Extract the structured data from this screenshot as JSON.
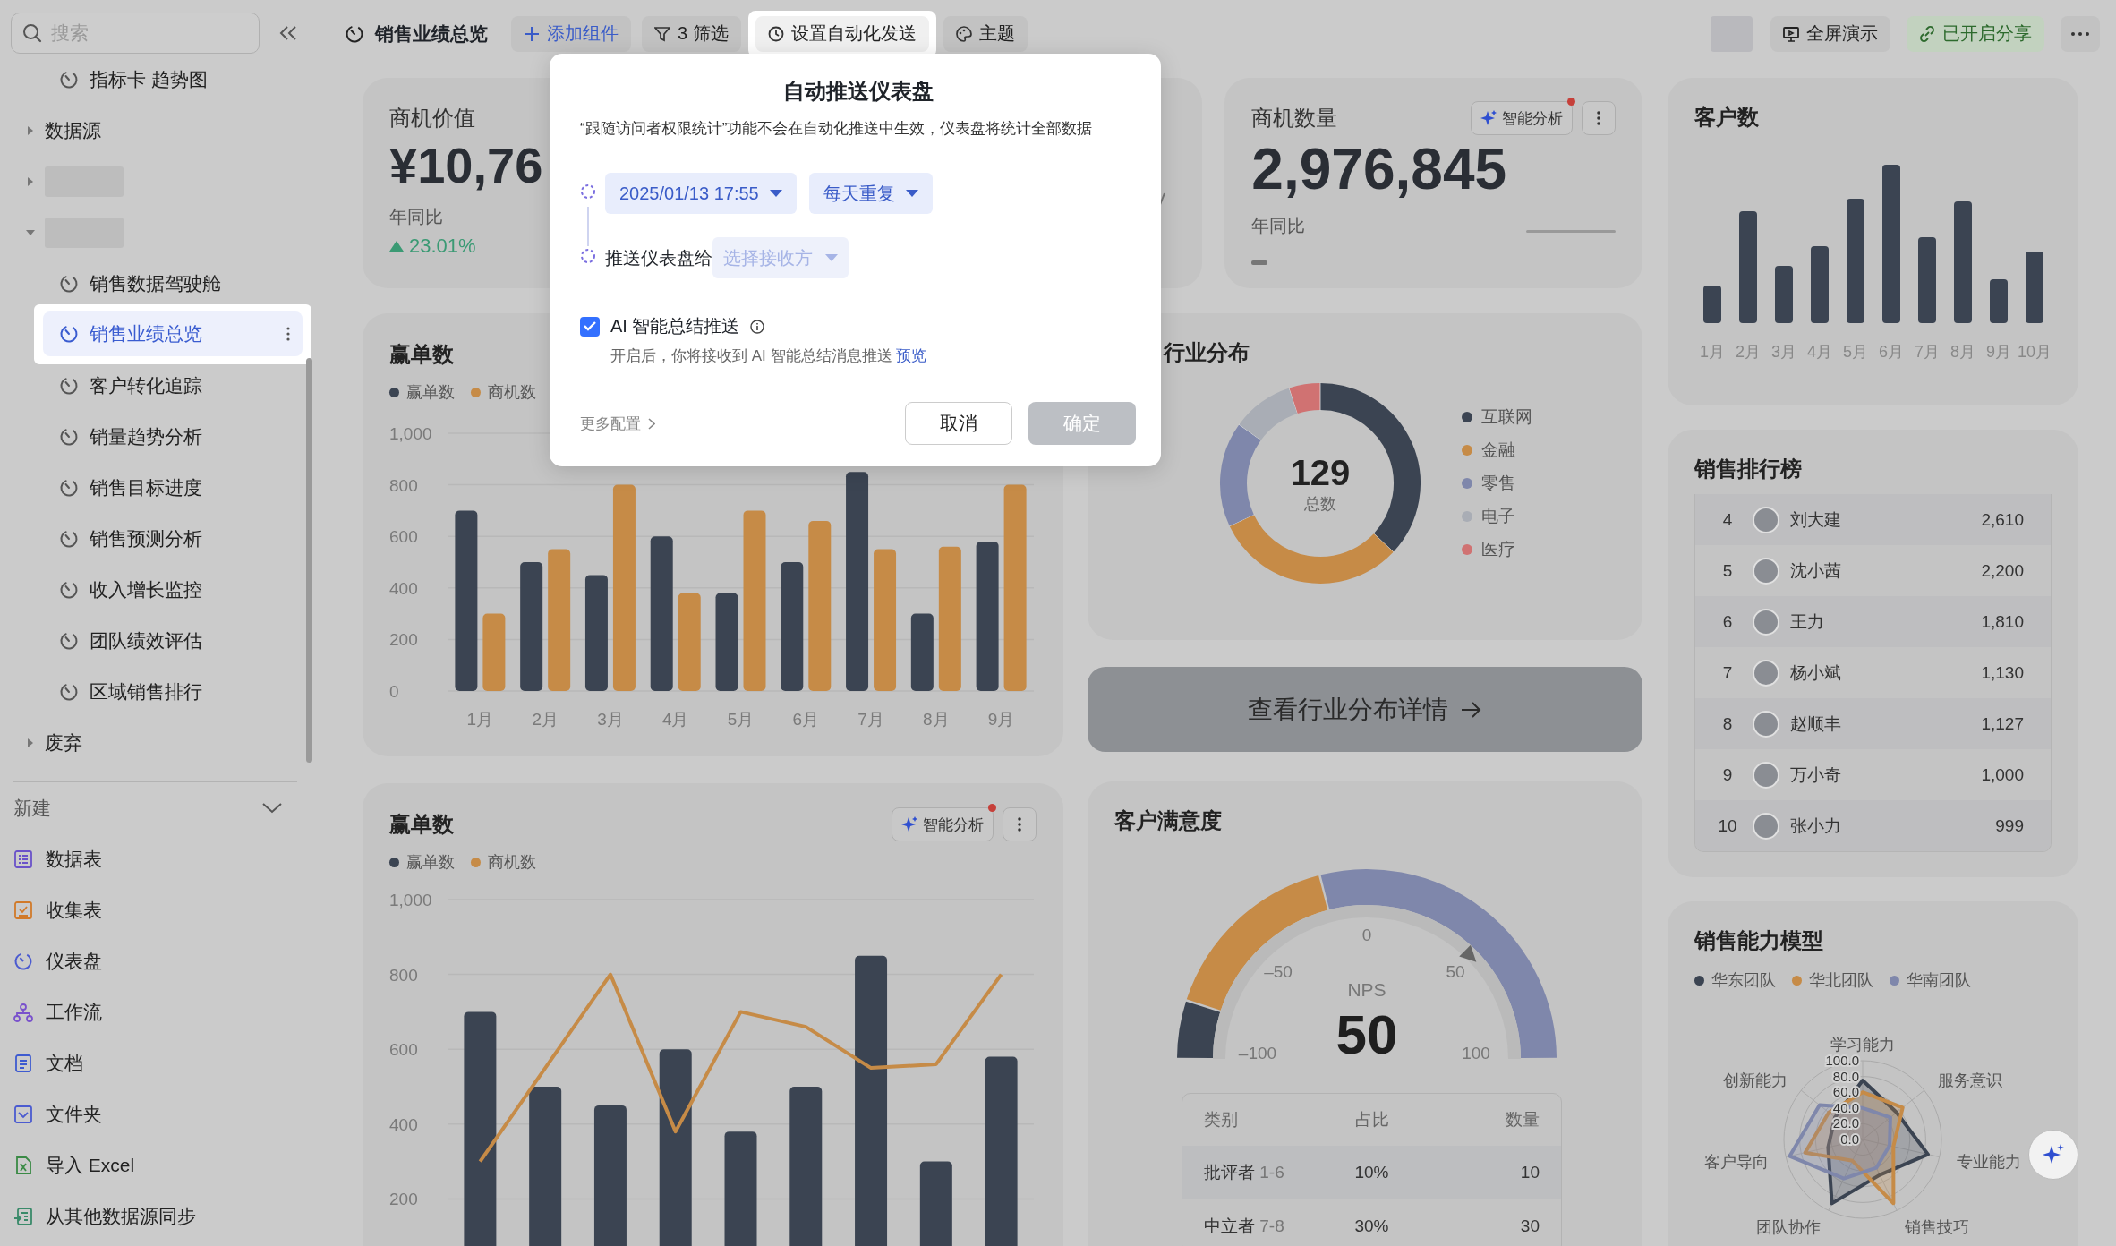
{
  "sidebar": {
    "search": {
      "placeholder": "搜索"
    },
    "tree": [
      {
        "kind": "dashboard",
        "label": "指标卡 趋势图",
        "selected": false
      },
      {
        "kind": "folder",
        "label": "数据源",
        "expanded": false
      },
      {
        "kind": "folder",
        "redacted": true,
        "expanded": false
      },
      {
        "kind": "folder",
        "redacted": true,
        "expanded": true,
        "children": [
          {
            "kind": "dashboard",
            "label": "销售数据驾驶舱",
            "selected": false
          },
          {
            "kind": "dashboard",
            "label": "销售业绩总览",
            "selected": true
          },
          {
            "kind": "dashboard",
            "label": "客户转化追踪",
            "selected": false
          },
          {
            "kind": "dashboard",
            "label": "销量趋势分析",
            "selected": false
          },
          {
            "kind": "dashboard",
            "label": "销售目标进度",
            "selected": false
          },
          {
            "kind": "dashboard",
            "label": "销售预测分析",
            "selected": false
          },
          {
            "kind": "dashboard",
            "label": "收入增长监控",
            "selected": false
          },
          {
            "kind": "dashboard",
            "label": "团队绩效评估",
            "selected": false
          },
          {
            "kind": "dashboard",
            "label": "区域销售排行",
            "selected": false
          }
        ]
      },
      {
        "kind": "folder",
        "label": "废弃",
        "expanded": false
      }
    ],
    "new_menu": {
      "label": "新建",
      "expanded": true,
      "items": [
        {
          "kind": "table",
          "label": "数据表"
        },
        {
          "kind": "form",
          "label": "收集表"
        },
        {
          "kind": "dashboard",
          "label": "仪表盘"
        },
        {
          "kind": "workflow",
          "label": "工作流"
        },
        {
          "kind": "doc",
          "label": "文档"
        },
        {
          "kind": "folder",
          "label": "文件夹"
        },
        {
          "kind": "excel",
          "label": "导入 Excel"
        },
        {
          "kind": "sync",
          "label": "从其他数据源同步"
        }
      ]
    }
  },
  "toolbar": {
    "title": "销售业绩总览",
    "buttons": [
      {
        "kind": "add",
        "label": "添加组件",
        "selected": false
      },
      {
        "kind": "filter",
        "label": "3 筛选",
        "selected": false
      },
      {
        "kind": "automation",
        "label": "设置自动化发送",
        "selected": true
      },
      {
        "kind": "theme",
        "label": "主题",
        "selected": false
      }
    ],
    "right_buttons": [
      {
        "kind": "avatar"
      },
      {
        "kind": "present",
        "label": "全屏演示"
      },
      {
        "kind": "share",
        "label": "已开启分享"
      },
      {
        "kind": "more"
      }
    ]
  },
  "kpi_cards": [
    {
      "kind": "metric",
      "title": "商机价值",
      "value": "¥10,76",
      "change_label": "年同比",
      "up": true,
      "change": "23.01%"
    },
    {
      "kind": "sparkline"
    },
    {
      "kind": "metric",
      "title": "商机数量",
      "ai_badge": {
        "label": "智能分析",
        "dot": true
      },
      "value": "2,976,845",
      "change_label": "年同比",
      "sparkline": true
    }
  ],
  "win_chart": {
    "title": "赢单数",
    "chart_data": {
      "type": "bar",
      "categories": [
        "1月",
        "2月",
        "3月",
        "4月",
        "5月",
        "6月",
        "7月",
        "8月",
        "9月"
      ],
      "series": [
        {
          "name": "赢单数",
          "color": "#3b4452",
          "values": [
            700,
            500,
            450,
            600,
            380,
            500,
            850,
            300,
            580
          ]
        },
        {
          "name": "商机数",
          "color": "#c68b47",
          "values": [
            300,
            550,
            800,
            380,
            700,
            660,
            550,
            560,
            800
          ]
        }
      ],
      "grid": true,
      "ylim": [
        0,
        1000
      ],
      "yticks": [
        {
          "value": 0,
          "label": "0"
        },
        {
          "value": 200,
          "label": "200"
        },
        {
          "value": 400,
          "label": "400"
        },
        {
          "value": 600,
          "label": "600"
        },
        {
          "value": 800,
          "label": "800"
        },
        {
          "value": 1000,
          "label": "1,000"
        }
      ]
    }
  },
  "win_combo_chart": {
    "title": "赢单数",
    "ai_badge": {
      "label": "智能分析",
      "dot": true
    },
    "chart_data": {
      "type": "bar",
      "series": [
        {
          "name": "赢单数",
          "color": "#3b4452",
          "type": "bar",
          "values": [
            700,
            500,
            450,
            600,
            380,
            500,
            850,
            300,
            580
          ]
        },
        {
          "name": "商机数",
          "color": "#c68b47",
          "type": "line",
          "values": [
            300,
            550,
            800,
            380,
            700,
            660,
            550,
            560,
            800
          ]
        }
      ],
      "grid": true,
      "ylim": [
        0,
        1000
      ],
      "yticks": [
        {
          "value": 200,
          "label": "200"
        },
        {
          "value": 400,
          "label": "400"
        },
        {
          "value": 600,
          "label": "600"
        },
        {
          "value": 800,
          "label": "800"
        },
        {
          "value": 1000,
          "label": "1,000"
        }
      ]
    }
  },
  "industry_card": {
    "title": "行业分布",
    "total": "129",
    "total_label": "总数",
    "segments": [
      {
        "label": "互联网",
        "color": "#3b4452"
      },
      {
        "label": "金融",
        "color": "#c68b47"
      },
      {
        "label": "零售",
        "color": "#7f87ab"
      },
      {
        "label": "电子",
        "color": "#a9adb5"
      },
      {
        "label": "医疗",
        "color": "#d07272"
      }
    ]
  },
  "industry_button": {
    "label": "查看行业分布详情"
  },
  "customers_card": {
    "title": "客户数",
    "months": [
      "1月",
      "2月",
      "3月",
      "4月",
      "5月",
      "6月",
      "7月",
      "8月",
      "9月",
      "10月"
    ]
  },
  "ranking_card": {
    "title": "销售排行榜",
    "rows": [
      {
        "rank": "4",
        "name": "刘大建",
        "score": "2,610"
      },
      {
        "rank": "5",
        "name": "沈小茜",
        "score": "2,200"
      },
      {
        "rank": "6",
        "name": "王力",
        "score": "1,810"
      },
      {
        "rank": "7",
        "name": "杨小斌",
        "score": "1,130"
      },
      {
        "rank": "8",
        "name": "赵顺丰",
        "score": "1,127"
      },
      {
        "rank": "9",
        "name": "万小奇",
        "score": "1,000"
      },
      {
        "rank": "10",
        "name": "张小力",
        "score": "999"
      }
    ]
  },
  "nps_card": {
    "title": "客户满意度",
    "gauge": {
      "label": "NPS",
      "value": "50",
      "ticks": [
        "–100",
        "–50",
        "0",
        "50",
        "100"
      ],
      "level": 0.75
    },
    "table": {
      "columns": [
        "类别",
        "占比",
        "数量"
      ],
      "rows": [
        {
          "category": "批评者",
          "range": "1-6",
          "share": "10%",
          "count": "10"
        },
        {
          "category": "中立者",
          "range": "7-8",
          "share": "30%",
          "count": "30"
        }
      ]
    }
  },
  "radar_card": {
    "title": "销售能力模型",
    "legend": [
      {
        "label": "华东团队",
        "color": "#3b4452"
      },
      {
        "label": "华北团队",
        "color": "#c68b47"
      },
      {
        "label": "华南团队",
        "color": "#7f87ab"
      }
    ],
    "axes": [
      "学习能力",
      "服务意识",
      "专业能力",
      "销售技巧",
      "团队协作",
      "客户导向",
      "创新能力"
    ],
    "ticks": [
      "100.0",
      "80.0",
      "60.0",
      "40.0",
      "20.0",
      "0.0"
    ]
  },
  "dialog": {
    "title": "自动推送仪表盘",
    "note": "“跟随访问者权限统计”功能不会在自动化推送中生效，仪表盘将统计全部数据",
    "schedule": {
      "date": "2025/01/13 17:55",
      "repeat": "每天重复"
    },
    "recipient": {
      "label": "推送仪表盘给",
      "placeholder": "选择接收方"
    },
    "ai_summary": {
      "label": "AI 智能总结推送",
      "checked": true,
      "description": "开启后，你将接收到 AI 智能总结消息推送",
      "link": "预览"
    },
    "more": "更多配置",
    "buttons": [
      {
        "kind": "cancel",
        "label": "取消",
        "disabled": false
      },
      {
        "kind": "confirm",
        "label": "确定",
        "disabled": true
      }
    ]
  }
}
